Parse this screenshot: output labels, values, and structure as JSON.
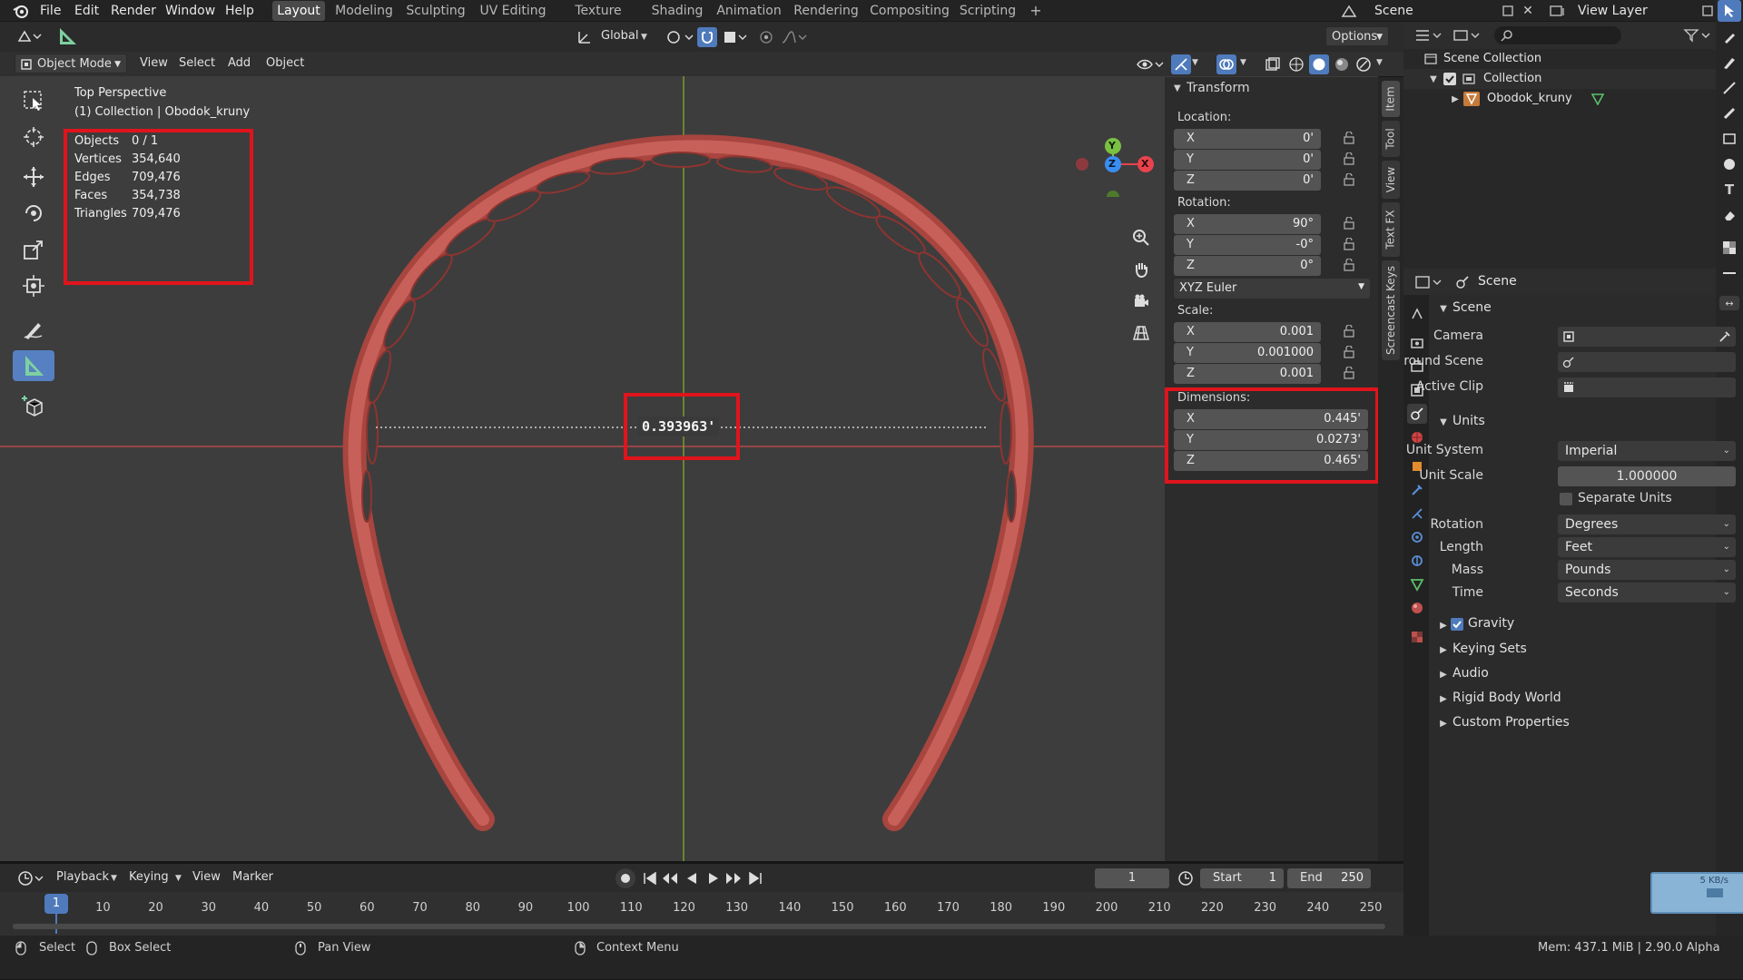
{
  "topbar": {
    "menus": [
      "File",
      "Edit",
      "Render",
      "Window",
      "Help"
    ],
    "workspaces": [
      "Layout",
      "Modeling",
      "Sculpting",
      "UV Editing",
      "Texture Paint",
      "Shading",
      "Animation",
      "Rendering",
      "Compositing",
      "Scripting"
    ],
    "active_workspace": "Layout",
    "scene": "Scene",
    "view_layer": "View Layer"
  },
  "header": {
    "orientation": "Global",
    "options": "Options",
    "mode": "Object Mode",
    "menus": [
      "View",
      "Select",
      "Add",
      "Object"
    ]
  },
  "viewport": {
    "view_name": "Top Perspective",
    "collection_line": "(1) Collection | Obodok_kruny",
    "stats": [
      {
        "label": "Objects",
        "value": "0 / 1"
      },
      {
        "label": "Vertices",
        "value": "354,640"
      },
      {
        "label": "Edges",
        "value": "709,476"
      },
      {
        "label": "Faces",
        "value": "354,738"
      },
      {
        "label": "Triangles",
        "value": "709,476"
      }
    ],
    "measure_value": "0.393963'",
    "gizmo": {
      "y": "Y",
      "z": "Z",
      "x": "X"
    }
  },
  "transform": {
    "title": "Transform",
    "location_label": "Location:",
    "location": [
      {
        "axis": "X",
        "value": "0'"
      },
      {
        "axis": "Y",
        "value": "0'"
      },
      {
        "axis": "Z",
        "value": "0'"
      }
    ],
    "rotation_label": "Rotation:",
    "rotation": [
      {
        "axis": "X",
        "value": "90°"
      },
      {
        "axis": "Y",
        "value": "-0°"
      },
      {
        "axis": "Z",
        "value": "0°"
      }
    ],
    "rotation_mode": "XYZ Euler",
    "scale_label": "Scale:",
    "scale": [
      {
        "axis": "X",
        "value": "0.001"
      },
      {
        "axis": "Y",
        "value": "0.001000"
      },
      {
        "axis": "Z",
        "value": "0.001"
      }
    ],
    "dimensions_label": "Dimensions:",
    "dimensions": [
      {
        "axis": "X",
        "value": "0.445'"
      },
      {
        "axis": "Y",
        "value": "0.0273'"
      },
      {
        "axis": "Z",
        "value": "0.465'"
      }
    ]
  },
  "side_tabs": [
    "Item",
    "Tool",
    "View",
    "Text FX",
    "Screencast Keys"
  ],
  "timeline": {
    "menus": [
      "Playback",
      "Keying",
      "View",
      "Marker"
    ],
    "current_frame": "1",
    "start_label": "Start",
    "start": "1",
    "end_label": "End",
    "end": "250",
    "ticks": [
      "1",
      "10",
      "20",
      "30",
      "40",
      "50",
      "60",
      "70",
      "80",
      "90",
      "100",
      "110",
      "120",
      "130",
      "140",
      "150",
      "160",
      "170",
      "180",
      "190",
      "200",
      "210",
      "220",
      "230",
      "240",
      "250"
    ]
  },
  "statusbar": {
    "select": "Select",
    "box_select": "Box Select",
    "pan_view": "Pan View",
    "context_menu": "Context Menu",
    "memory": "Mem: 437.1 MiB | 2.90.0 Alpha",
    "net_speed": "5 KB/s"
  },
  "outliner": {
    "scene_collection": "Scene Collection",
    "collection": "Collection",
    "object": "Obodok_kruny"
  },
  "properties": {
    "context": "Scene",
    "scene_panel": "Scene",
    "camera_label": "Camera",
    "background_label": "Background Scene",
    "clip_label": "Active Clip",
    "units_panel": "Units",
    "unit_system_label": "Unit System",
    "unit_system": "Imperial",
    "unit_scale_label": "Unit Scale",
    "unit_scale": "1.000000",
    "separate_units": "Separate Units",
    "rotation_label": "Rotation",
    "rotation": "Degrees",
    "length_label": "Length",
    "length": "Feet",
    "mass_label": "Mass",
    "mass": "Pounds",
    "time_label": "Time",
    "time": "Seconds",
    "collapsed": [
      "Gravity",
      "Keying Sets",
      "Audio",
      "Rigid Body World",
      "Custom Properties"
    ]
  },
  "colors": {
    "highlight": "#e0141c",
    "accent": "#5680c2",
    "mesh": "#b85450"
  }
}
